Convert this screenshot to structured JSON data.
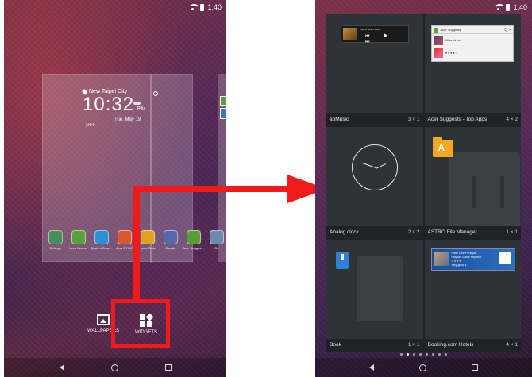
{
  "left_phone": {
    "status": {
      "time": "1:40"
    },
    "clock_widget": {
      "city": "New Taipei City",
      "time": "10:32",
      "ampm": "PM",
      "date": "Tue, May 19",
      "alarm": "OFF"
    },
    "dock_apps": [
      {
        "label": "Settings",
        "color": "#4a8c5a"
      },
      {
        "label": "Nexo Access",
        "color": "#5aa13a"
      },
      {
        "label": "System Sma...",
        "color": "#2d8fd6"
      },
      {
        "label": "Acer BYOC",
        "color": "#d9572a"
      },
      {
        "label": "Home Suite",
        "color": "#e0a020"
      },
      {
        "label": "Google",
        "color": "#5566aa"
      },
      {
        "label": "Acer Sugges...",
        "color": "#5a9e3b"
      },
      {
        "label": "Ge",
        "color": "#6d8bb0"
      }
    ],
    "actions": {
      "wallpapers": "WALLPAPERS",
      "widgets": "WIDGETS"
    },
    "nav": {
      "back": "◁",
      "home": "○",
      "recent": "□"
    }
  },
  "right_phone": {
    "status": {
      "time": "1:40"
    },
    "music_preview": {
      "title": "Tap to select track",
      "controls": "⏮ ▶ ⏭"
    },
    "suggest_preview": {
      "header": "Acer Suggests",
      "header_ctrls": "Q  >",
      "rows": [
        "Million Arthur",
        "★★★★☆"
      ]
    },
    "booking_preview": {
      "line1": "Hotel Leone Prague",
      "line2": "Prague, Czech Republic",
      "stars": "★★★★",
      "line3": "Very good  8.1"
    },
    "widgets": [
      {
        "name": "abMusic",
        "size": "3 × 1"
      },
      {
        "name": "Acer Suggests - Top Apps",
        "size": "4 × 2"
      },
      {
        "name": "Analog clock",
        "size": "2 × 2"
      },
      {
        "name": "ASTRO File Manager",
        "size": "1 × 1"
      },
      {
        "name": "Book",
        "size": "1 × 1"
      },
      {
        "name": "Booking.com Hotels",
        "size": "4 × 1"
      }
    ],
    "folder_letter": "A",
    "page_count": 8,
    "active_page": 1
  }
}
